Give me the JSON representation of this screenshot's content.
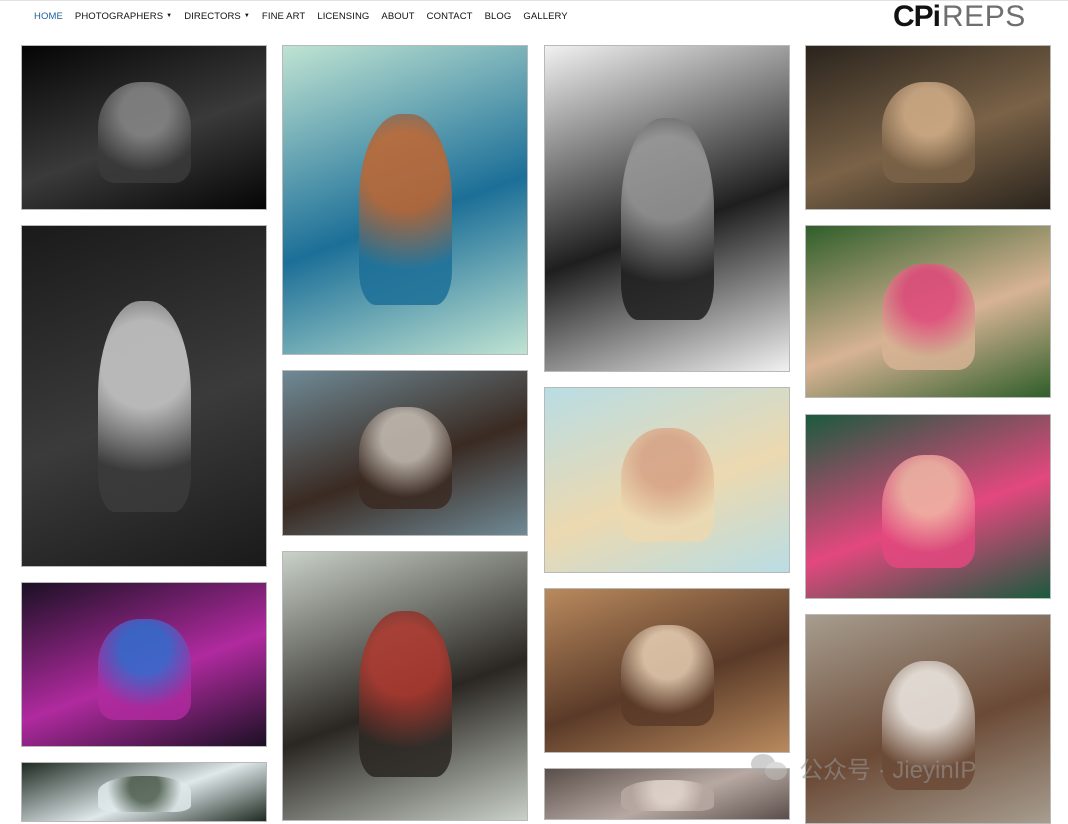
{
  "nav": {
    "items": [
      {
        "label": "HOME",
        "active": true,
        "dropdown": false
      },
      {
        "label": "PHOTOGRAPHERS",
        "active": false,
        "dropdown": true
      },
      {
        "label": "DIRECTORS",
        "active": false,
        "dropdown": true
      },
      {
        "label": "FINE ART",
        "active": false,
        "dropdown": false
      },
      {
        "label": "LICENSING",
        "active": false,
        "dropdown": false
      },
      {
        "label": "ABOUT",
        "active": false,
        "dropdown": false
      },
      {
        "label": "CONTACT",
        "active": false,
        "dropdown": false
      },
      {
        "label": "BLOG",
        "active": false,
        "dropdown": false
      },
      {
        "label": "GALLERY",
        "active": false,
        "dropdown": false
      }
    ],
    "caret": "▼",
    "active_color": "#1f5e9c"
  },
  "logo": {
    "bold": "CPi",
    "thin": "REPS"
  },
  "gallery": {
    "tiles": [
      {
        "subject": "night street silhouette",
        "palette": [
          "#050505",
          "#3a3a3a",
          "#8a8a8a"
        ]
      },
      {
        "subject": "old man with beard and hat",
        "palette": [
          "#1a1a1a",
          "#3b3b3b",
          "#cfcfcf"
        ]
      },
      {
        "subject": "dancers in colorful dresses",
        "palette": [
          "#1b1024",
          "#b02a9f",
          "#2f6fd0"
        ]
      },
      {
        "subject": "trees and sky",
        "palette": [
          "#1e2a22",
          "#dfe8ea",
          "#4a5a4a"
        ]
      },
      {
        "subject": "old man holding basketball",
        "palette": [
          "#bfe3d2",
          "#1c6f98",
          "#c2652e"
        ]
      },
      {
        "subject": "man on motorcycle",
        "palette": [
          "#6f8a96",
          "#3a2a22",
          "#c8c0b6"
        ]
      },
      {
        "subject": "woman portrait with beaded necklace",
        "palette": [
          "#c9d1c8",
          "#2a2622",
          "#b2392f"
        ]
      },
      {
        "subject": "woman jumping on bed",
        "palette": [
          "#f1f1f1",
          "#1e1e1e",
          "#9a9a9a"
        ]
      },
      {
        "subject": "man on beach with birds",
        "palette": [
          "#b9dde4",
          "#ecd9b0",
          "#d6a083"
        ]
      },
      {
        "subject": "two smiling children",
        "palette": [
          "#b98a5e",
          "#5a3a28",
          "#e8d0b4"
        ]
      },
      {
        "subject": "cloudy sky",
        "palette": [
          "#5a4e4a",
          "#b7a9a2",
          "#e2d6cf"
        ]
      },
      {
        "subject": "old man carving wood",
        "palette": [
          "#2a241d",
          "#7a6247",
          "#d4b08a"
        ]
      },
      {
        "subject": "two kids with sunglasses",
        "palette": [
          "#2f5e2a",
          "#d7b394",
          "#e0467a"
        ]
      },
      {
        "subject": "woman on donut float",
        "palette": [
          "#1b5a3e",
          "#e3487e",
          "#f2b9a6"
        ]
      },
      {
        "subject": "smiling boy portrait",
        "palette": [
          "#a79d8f",
          "#6b4a36",
          "#f0ece6"
        ]
      }
    ]
  },
  "watermark": {
    "text": "公众号 · JieyinIP"
  }
}
